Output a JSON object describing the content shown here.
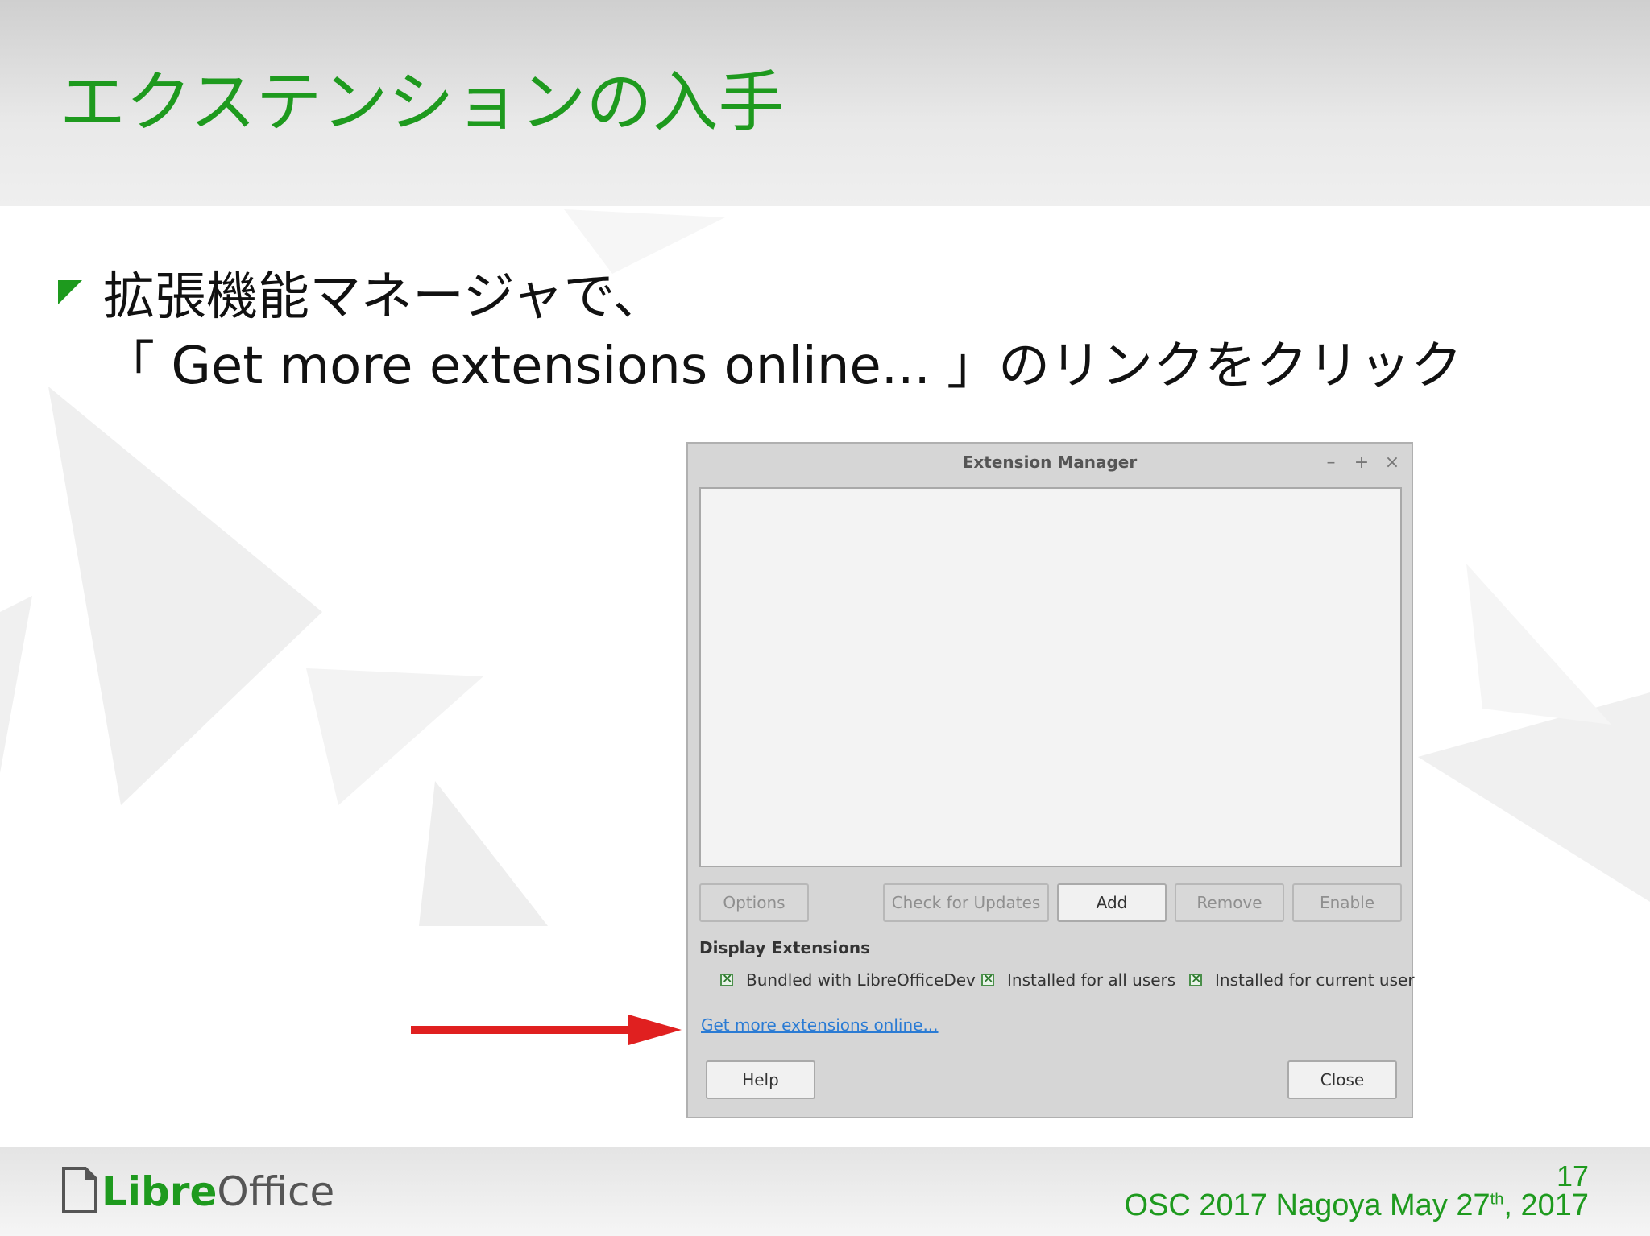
{
  "slide": {
    "title": "エクステンションの入手",
    "bullet_line1": "拡張機能マネージャで、",
    "bullet_line2": "「 Get more extensions online... 」のリンクをクリック"
  },
  "dialog": {
    "title": "Extension Manager",
    "window_controls": {
      "minimize": "–",
      "maximize": "+",
      "close": "×"
    },
    "buttons": {
      "options": "Options",
      "check_updates": "Check for Updates",
      "add": "Add",
      "remove": "Remove",
      "enable": "Enable",
      "help": "Help",
      "close": "Close"
    },
    "display_extensions_label": "Display Extensions",
    "checkboxes": [
      {
        "label": "Bundled with LibreOfficeDev",
        "checked": true
      },
      {
        "label": "Installed for all users",
        "checked": true
      },
      {
        "label": "Installed for current user",
        "checked": true
      }
    ],
    "link": "Get more extensions online..."
  },
  "footer": {
    "logo_libre": "Libre",
    "logo_office": "Office",
    "page_number": "17",
    "event_prefix": "OSC 2017 Nagoya May 27",
    "event_sup": "th",
    "event_suffix": ", 2017"
  },
  "colors": {
    "accent_green": "#1e9a1e",
    "arrow_red": "#e02020",
    "link_blue": "#2a7bd4"
  }
}
